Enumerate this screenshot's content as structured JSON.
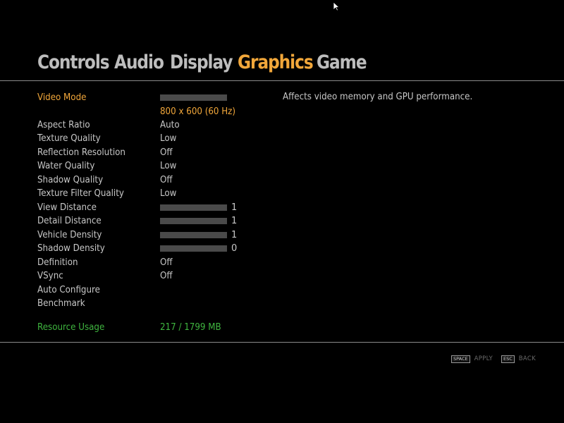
{
  "tabs": [
    {
      "label": "Controls",
      "active": false
    },
    {
      "label": "Audio",
      "active": false
    },
    {
      "label": "Display",
      "active": false
    },
    {
      "label": "Graphics",
      "active": true
    },
    {
      "label": "Game",
      "active": false
    }
  ],
  "settings": {
    "video_mode": {
      "label": "Video Mode",
      "value": "800 x 600 (60 Hz)"
    },
    "aspect_ratio": {
      "label": "Aspect Ratio",
      "value": "Auto"
    },
    "texture_quality": {
      "label": "Texture Quality",
      "value": "Low"
    },
    "reflection_resolution": {
      "label": "Reflection Resolution",
      "value": "Off"
    },
    "water_quality": {
      "label": "Water Quality",
      "value": "Low"
    },
    "shadow_quality": {
      "label": "Shadow Quality",
      "value": "Off"
    },
    "texture_filter_quality": {
      "label": "Texture Filter Quality",
      "value": "Low"
    },
    "view_distance": {
      "label": "View Distance",
      "value": "1"
    },
    "detail_distance": {
      "label": "Detail Distance",
      "value": "1"
    },
    "vehicle_density": {
      "label": "Vehicle Density",
      "value": "1"
    },
    "shadow_density": {
      "label": "Shadow Density",
      "value": "0"
    },
    "definition": {
      "label": "Definition",
      "value": "Off"
    },
    "vsync": {
      "label": "VSync",
      "value": "Off"
    },
    "auto_configure": {
      "label": "Auto Configure"
    },
    "benchmark": {
      "label": "Benchmark"
    },
    "resource_usage": {
      "label": "Resource Usage",
      "value": "217 / 1799 MB"
    }
  },
  "description": "Affects video memory and GPU performance.",
  "footer": {
    "apply_key": "SPACE",
    "apply_label": "APPLY",
    "back_key": "ESC",
    "back_label": "BACK"
  },
  "colors": {
    "active_tab": "#f2a73a",
    "tab": "#bdbdbd",
    "text": "#c8c8c8",
    "highlight": "#f2a73a",
    "resource": "#3fb53f",
    "background": "#000000"
  },
  "icons": {
    "cursor": "arrow-cursor-icon"
  }
}
